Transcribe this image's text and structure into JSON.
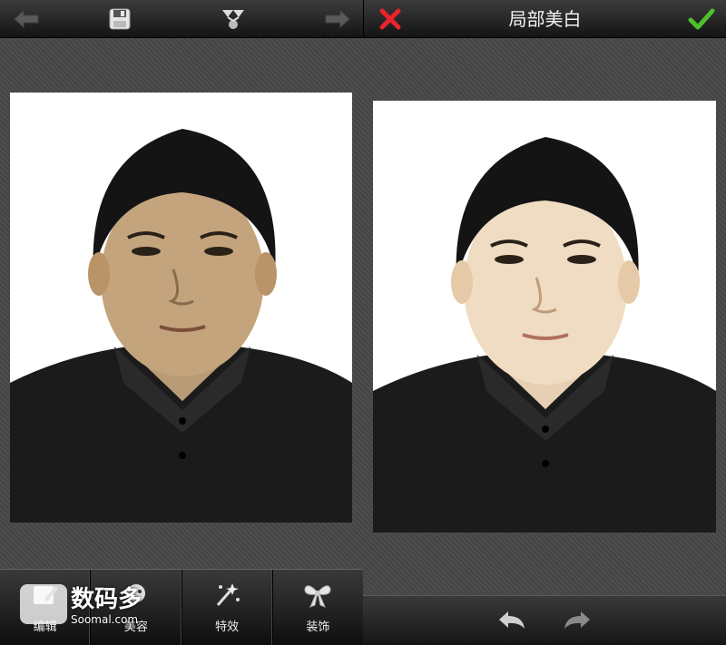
{
  "header_left": {
    "icons": [
      "back-arrow-icon",
      "save-icon",
      "share-icon",
      "forward-arrow-icon"
    ]
  },
  "header_right": {
    "title": "局部美白",
    "cancel_icon": "close-icon",
    "confirm_icon": "check-icon",
    "colors": {
      "cancel": "#e8242a",
      "confirm": "#4fbf2a"
    }
  },
  "toolbar": {
    "items": [
      {
        "label": "编辑",
        "icon": "edit-icon"
      },
      {
        "label": "美容",
        "icon": "beauty-icon"
      },
      {
        "label": "特效",
        "icon": "magic-wand-icon"
      },
      {
        "label": "装饰",
        "icon": "bow-icon"
      }
    ]
  },
  "watermark": {
    "text": "数码多",
    "sub": "Soomal.com"
  },
  "bottom_right": {
    "icons": [
      "undo-icon",
      "redo-icon"
    ]
  }
}
